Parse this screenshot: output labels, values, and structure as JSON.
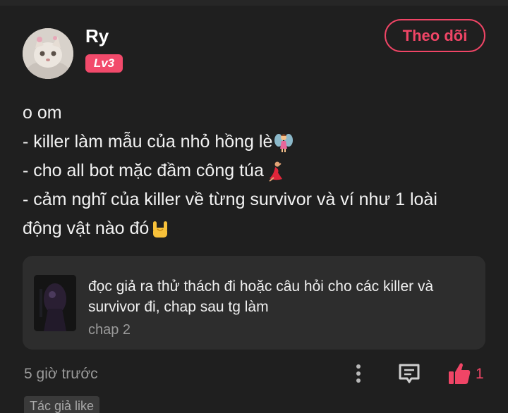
{
  "user": {
    "name": "Ry",
    "level": "Lv3",
    "follow_label": "Theo dõi"
  },
  "post": {
    "lines": [
      "o om",
      "- killer làm mẫu của nhỏ hồng lè",
      "- cho all bot mặc đầm công túa",
      "- cảm nghĩ của killer về từng survivor và ví như 1 loài",
      "động vật nào đó"
    ],
    "emojis": [
      "fairy-emoji",
      "dancer-emoji",
      "rock-hand-emoji"
    ]
  },
  "chapter_card": {
    "title": "đọc giả ra thử thách đi hoặc câu hỏi cho các killer và survivor đi, chap sau tg làm",
    "chapter": "chap 2"
  },
  "footer": {
    "time": "5 giờ trước",
    "like_count": "1",
    "author_like": "Tác giả like"
  },
  "colors": {
    "accent": "#f04566",
    "background": "#1f1f1f",
    "card": "#2d2d2d",
    "muted": "#9a9a9a"
  },
  "icons": [
    "more-vertical-icon",
    "comment-icon",
    "thumbs-up-icon"
  ]
}
